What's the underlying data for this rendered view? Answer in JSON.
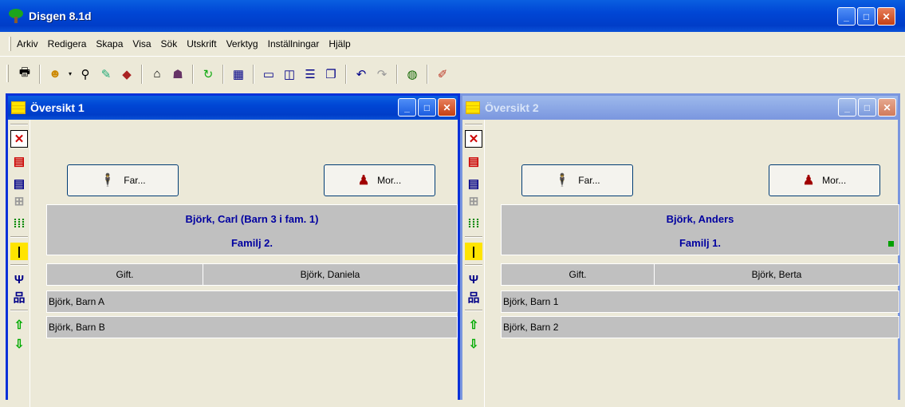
{
  "app": {
    "title": "Disgen 8.1d"
  },
  "menu": [
    {
      "label": "Arkiv"
    },
    {
      "label": "Redigera"
    },
    {
      "label": "Skapa"
    },
    {
      "label": "Visa"
    },
    {
      "label": "Sök"
    },
    {
      "label": "Utskrift"
    },
    {
      "label": "Verktyg"
    },
    {
      "label": "Inställningar"
    },
    {
      "label": "Hjälp"
    }
  ],
  "toolbar_icons": [
    "printer-icon",
    "person-icon",
    "binoculars-icon",
    "notes-icon",
    "book-icon",
    "home-icon",
    "family-icon",
    "refresh-icon",
    "calendar-icon",
    "window-single-icon",
    "window-split-icon",
    "window-horizontal-icon",
    "window-cascade-icon",
    "undo-icon",
    "redo-icon",
    "globe-icon",
    "book-pen-icon"
  ],
  "windows": [
    {
      "title": "Översikt 1",
      "father_label": "Far...",
      "mother_label": "Mor...",
      "person": "Björk, Carl (Barn 3 i fam. 1)",
      "family": "Familj 2.",
      "marriage": "Gift.",
      "spouse": "Björk, Daniela",
      "children": [
        "Björk, Barn A",
        "Björk, Barn B"
      ]
    },
    {
      "title": "Översikt 2",
      "father_label": "Far...",
      "mother_label": "Mor...",
      "person": "Björk, Anders",
      "family": "Familj 1.",
      "marriage": "Gift.",
      "spouse": "Björk, Berta",
      "children": [
        "Björk, Barn 1",
        "Björk, Barn 2"
      ]
    }
  ],
  "colors": {
    "title_active": "#0046d5",
    "title_inactive": "#7a96df",
    "person_text": "#0000a0",
    "panel_gray": "#c0c0c0"
  }
}
